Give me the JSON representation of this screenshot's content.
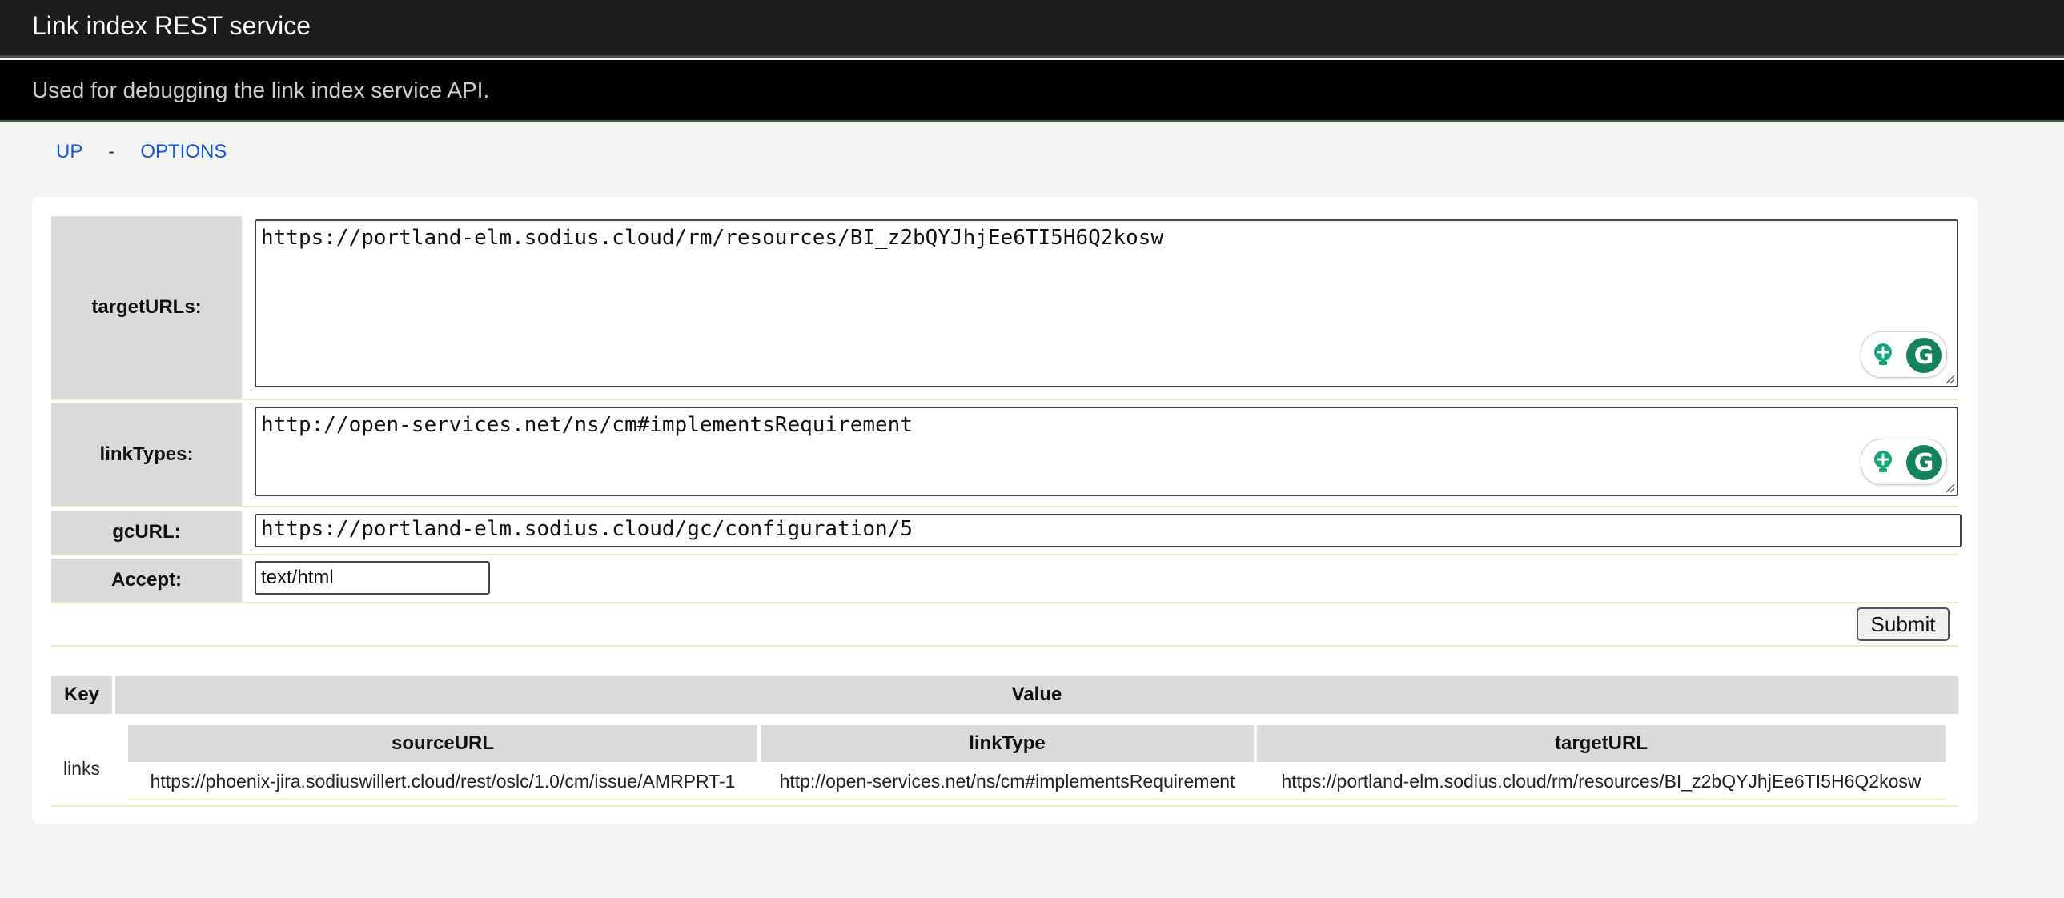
{
  "header": {
    "title": "Link index REST service",
    "description": "Used for debugging the link index service API."
  },
  "nav": {
    "up": "UP",
    "separator": "-",
    "options": "OPTIONS"
  },
  "form": {
    "target_urls": {
      "label": "targetURLs:",
      "value": "https://portland-elm.sodius.cloud/rm/resources/BI_z2bQYJhjEe6TI5H6Q2kosw"
    },
    "link_types": {
      "label": "linkTypes:",
      "value": "http://open-services.net/ns/cm#implementsRequirement"
    },
    "gc_url": {
      "label": "gcURL:",
      "value": "https://portland-elm.sodius.cloud/gc/configuration/5"
    },
    "accept": {
      "label": "Accept:",
      "value": "text/html"
    },
    "submit_label": "Submit"
  },
  "grammarly": {
    "g_glyph": "G"
  },
  "results": {
    "headers": {
      "key": "Key",
      "value": "Value"
    },
    "row_key": "links",
    "columns": [
      "sourceURL",
      "linkType",
      "targetURL"
    ],
    "row": [
      "https://phoenix-jira.sodiuswillert.cloud/rest/oslc/1.0/cm/issue/AMRPRT-1",
      "http://open-services.net/ns/cm#implementsRequirement",
      "https://portland-elm.sodius.cloud/rm/resources/BI_z2bQYJhjEe6TI5H6Q2kosw"
    ]
  },
  "colors": {
    "link": "#1658d8",
    "header_bg": "#1c1c1c",
    "subheader_bg": "#000000",
    "label_bg": "#dadada",
    "grammarly_green": "#15825f"
  }
}
